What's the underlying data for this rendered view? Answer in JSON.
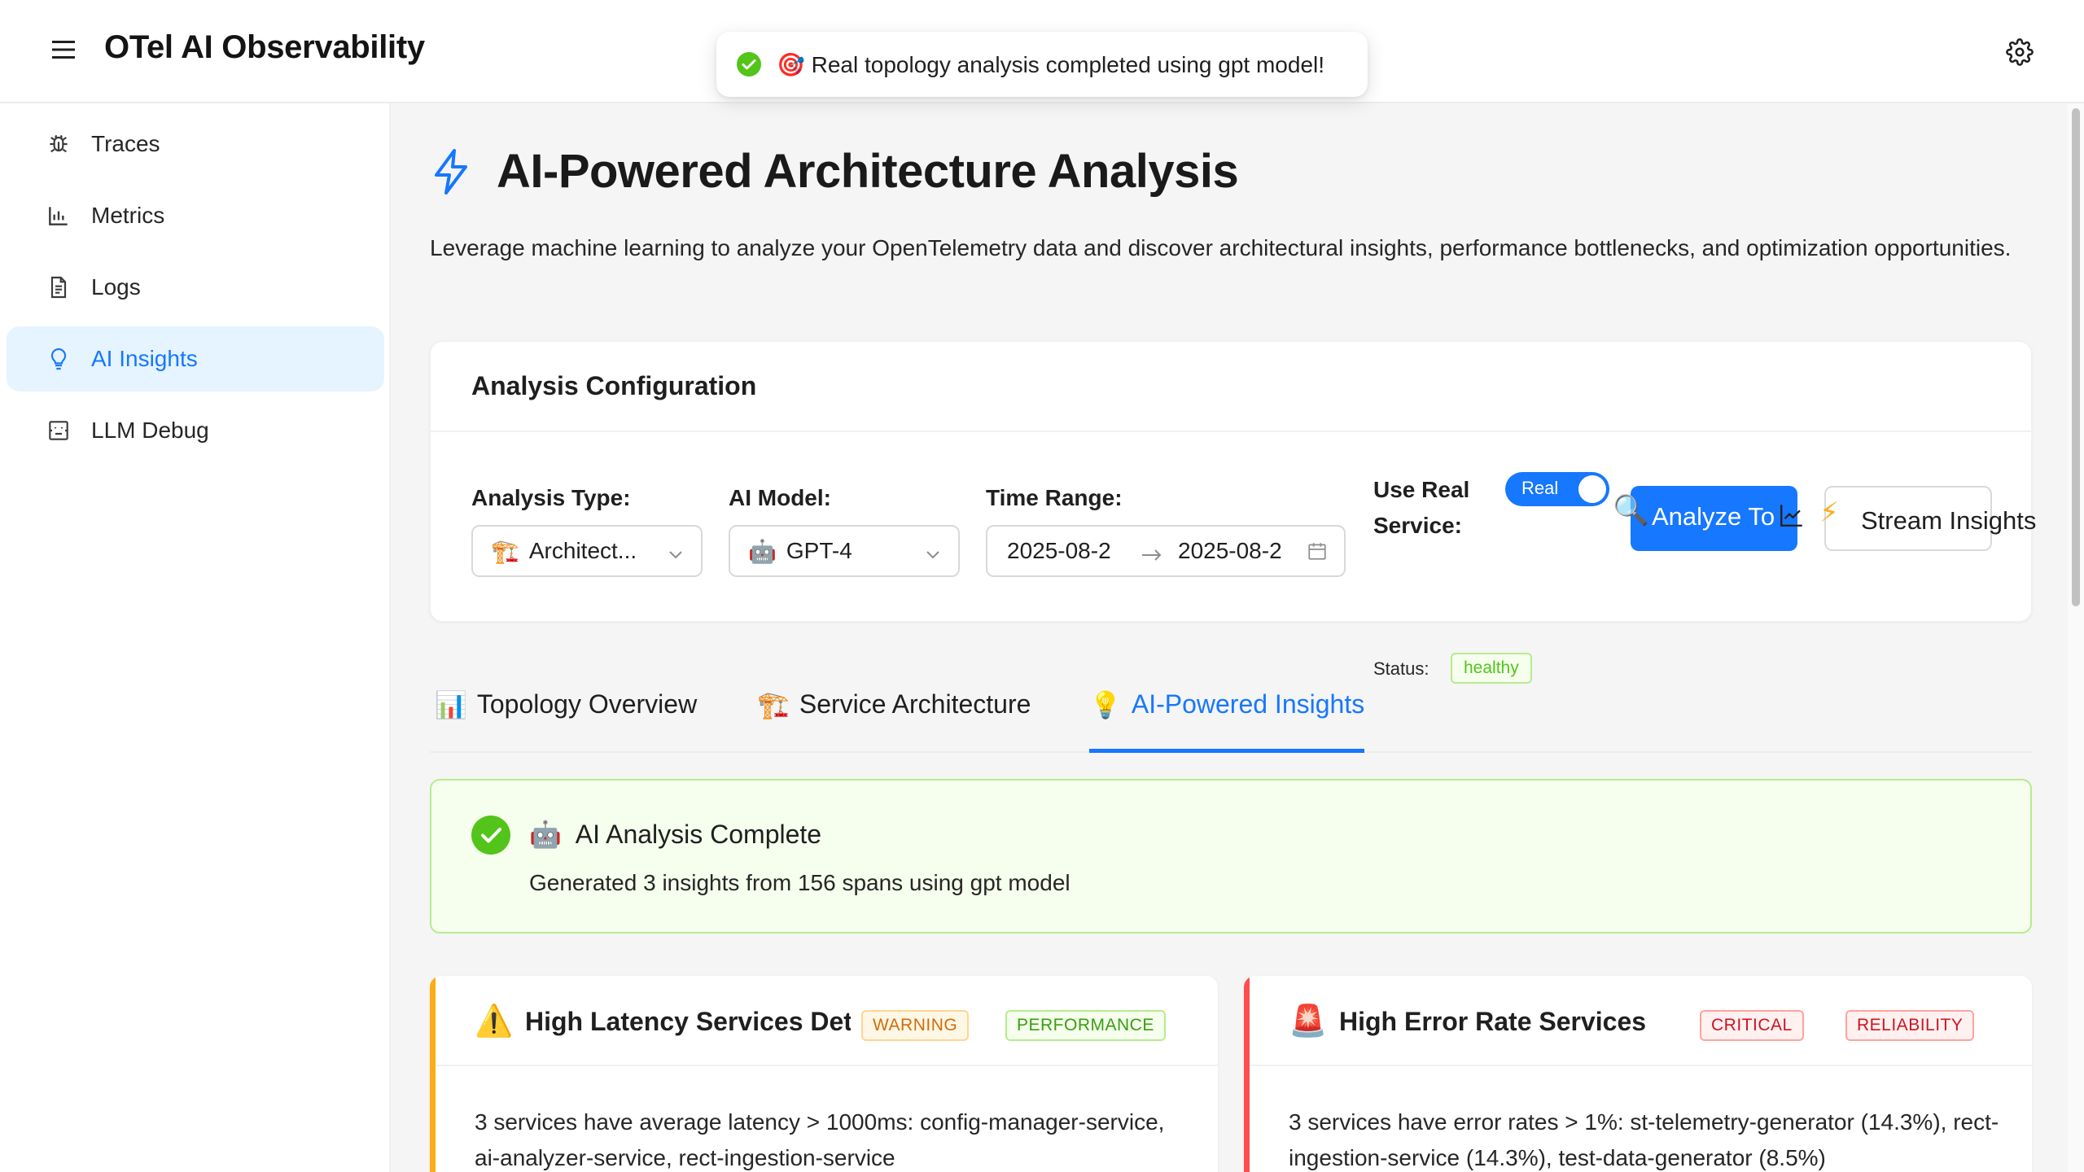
{
  "app": {
    "title": "OTel AI Observability"
  },
  "toast": {
    "message": "🎯 Real topology analysis completed using gpt model!"
  },
  "sidebar": {
    "items": [
      {
        "label": "Traces",
        "icon": "bug-icon"
      },
      {
        "label": "Metrics",
        "icon": "bar-chart-icon"
      },
      {
        "label": "Logs",
        "icon": "file-text-icon"
      },
      {
        "label": "AI Insights",
        "icon": "bulb-icon",
        "active": true
      },
      {
        "label": "LLM Debug",
        "icon": "robot-icon"
      }
    ]
  },
  "page": {
    "title": "AI-Powered Architecture Analysis",
    "description": "Leverage machine learning to analyze your OpenTelemetry data and discover architectural insights, performance bottlenecks, and optimization opportunities."
  },
  "config": {
    "heading": "Analysis Configuration",
    "analysis_type_label": "Analysis Type:",
    "analysis_type_emoji": "🏗️",
    "analysis_type_value": "Architect...",
    "ai_model_label": "AI Model:",
    "ai_model_emoji": "🤖",
    "ai_model_value": "GPT-4",
    "time_range_label": "Time Range:",
    "time_start": "2025-08-2",
    "time_end": "2025-08-2",
    "use_real_label_line1": "Use Real",
    "use_real_label_line2": "Service:",
    "switch_text": "Real",
    "switch_on": true,
    "status_label": "Status:",
    "status_value": "healthy",
    "analyze_button": "Analyze To",
    "analyze_icon": "🔍",
    "stream_icon": "⚡",
    "stream_button": "Stream Insights"
  },
  "tabs": [
    {
      "emoji": "📊",
      "label": "Topology Overview"
    },
    {
      "emoji": "🏗️",
      "label": "Service Architecture"
    },
    {
      "emoji": "💡",
      "label": "AI-Powered Insights",
      "active": true
    }
  ],
  "result": {
    "emoji": "🤖",
    "title": "AI Analysis Complete",
    "subtitle": "Generated 3 insights from 156 spans using gpt model"
  },
  "insights": [
    {
      "emoji": "⚠️",
      "title": "High Latency Services Dete",
      "severity": "WARNING",
      "category": "PERFORMANCE",
      "accent": "#faad14",
      "body": "3 services have average latency > 1000ms: config-manager-service, ai-analyzer-service, rect-ingestion-service"
    },
    {
      "emoji": "🚨",
      "title": "High Error Rate Services",
      "severity": "CRITICAL",
      "category": "RELIABILITY",
      "accent": "#ff4d4f",
      "body": "3 services have error rates > 1%: st-telemetry-generator (14.3%), rect-ingestion-service (14.3%), test-data-generator (8.5%)"
    }
  ]
}
